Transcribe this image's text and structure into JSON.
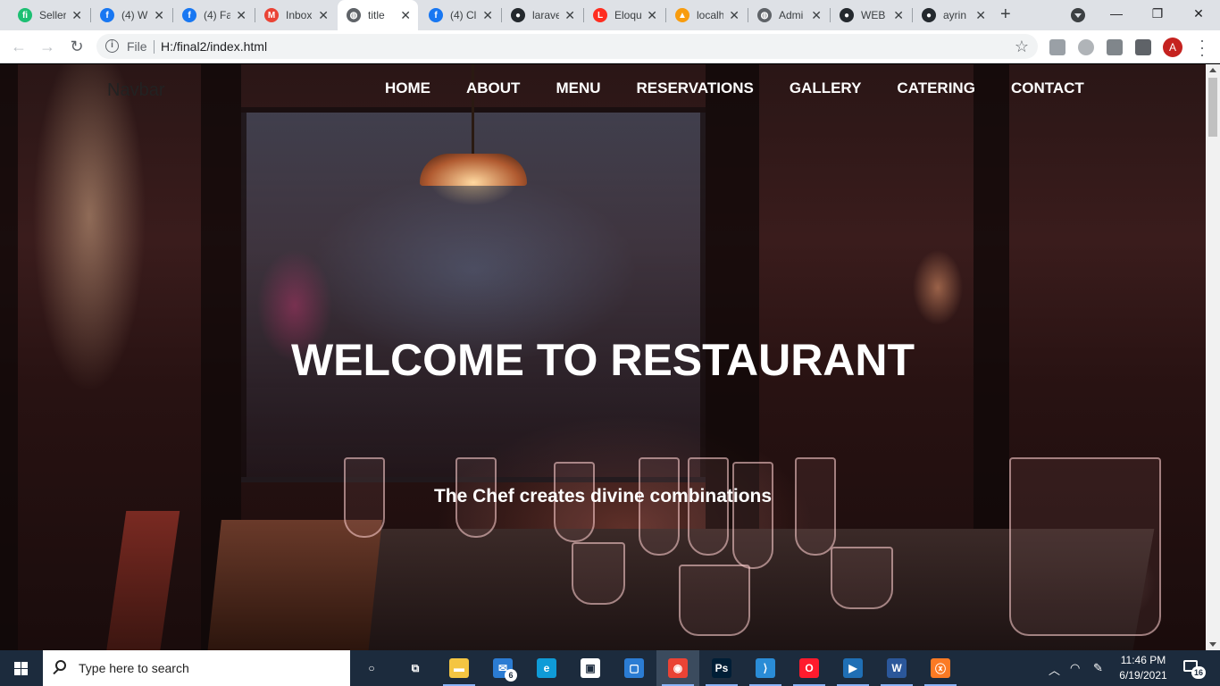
{
  "browser": {
    "tabs": [
      {
        "label": "Seller",
        "icon": "fiverr-icon",
        "color": "#1dbf73",
        "glyph": "fi"
      },
      {
        "label": "(4) W",
        "icon": "facebook-icon",
        "color": "#1877f2",
        "glyph": "f"
      },
      {
        "label": "(4) Fa",
        "icon": "facebook-icon",
        "color": "#1877f2",
        "glyph": "f"
      },
      {
        "label": "Inbox",
        "icon": "gmail-icon",
        "color": "#ea4335",
        "glyph": "M"
      },
      {
        "label": "title",
        "icon": "globe-icon",
        "color": "#5f6368",
        "glyph": "◍",
        "active": true
      },
      {
        "label": "(4) Cl",
        "icon": "facebook-icon",
        "color": "#1877f2",
        "glyph": "f"
      },
      {
        "label": "larave",
        "icon": "github-icon",
        "color": "#24292e",
        "glyph": "●"
      },
      {
        "label": "Eloqu",
        "icon": "laravel-icon",
        "color": "#ff2d20",
        "glyph": "L"
      },
      {
        "label": "localh",
        "icon": "phpmyadmin-icon",
        "color": "#f89c0e",
        "glyph": "▲"
      },
      {
        "label": "Admi",
        "icon": "globe-icon",
        "color": "#5f6368",
        "glyph": "◍"
      },
      {
        "label": "WEB",
        "icon": "github-icon",
        "color": "#24292e",
        "glyph": "●"
      },
      {
        "label": "ayrin",
        "icon": "github-icon",
        "color": "#24292e",
        "glyph": "●"
      }
    ],
    "close_glyph": "✕",
    "new_tab_glyph": "+",
    "window_controls": {
      "minimize": "—",
      "restore": "❐",
      "close": "✕"
    },
    "address": {
      "scheme_label": "File",
      "url": "H:/final2/index.html"
    },
    "profile_initial": "A"
  },
  "page": {
    "brand": "Navbar",
    "nav_links": [
      "HOME",
      "ABOUT",
      "MENU",
      "RESERVATIONS",
      "GALLERY",
      "CATERING",
      "CONTACT"
    ],
    "hero_title": "WELCOME TO RESTAURANT",
    "hero_subtitle": "The Chef creates divine combinations"
  },
  "taskbar": {
    "search_placeholder": "Type here to search",
    "apps": [
      {
        "name": "cortana-icon",
        "glyph": "○"
      },
      {
        "name": "task-view-icon",
        "glyph": "⧉"
      },
      {
        "name": "file-explorer-icon",
        "glyph": "▬",
        "color": "#f4c542"
      },
      {
        "name": "mail-icon",
        "glyph": "✉",
        "color": "#2b7cd3",
        "badge": "6"
      },
      {
        "name": "edge-icon",
        "glyph": "e",
        "color": "#0f9bd7"
      },
      {
        "name": "store-icon",
        "glyph": "▣",
        "color": "#ffffff"
      },
      {
        "name": "phone-link-icon",
        "glyph": "▢",
        "color": "#2b7cd3"
      },
      {
        "name": "chrome-icon",
        "glyph": "◉",
        "color": "#ea4335",
        "active": true
      },
      {
        "name": "photoshop-icon",
        "glyph": "Ps",
        "color": "#001e36"
      },
      {
        "name": "vscode-icon",
        "glyph": "⟩",
        "color": "#2a8cd6"
      },
      {
        "name": "opera-icon",
        "glyph": "O",
        "color": "#ff1b2d"
      },
      {
        "name": "media-player-icon",
        "glyph": "▶",
        "color": "#1f6fb5"
      },
      {
        "name": "word-icon",
        "glyph": "W",
        "color": "#2b579a"
      },
      {
        "name": "xampp-icon",
        "glyph": "ⓧ",
        "color": "#fb7a24"
      }
    ],
    "time": "11:46 PM",
    "date": "6/19/2021",
    "notification_count": "16"
  }
}
